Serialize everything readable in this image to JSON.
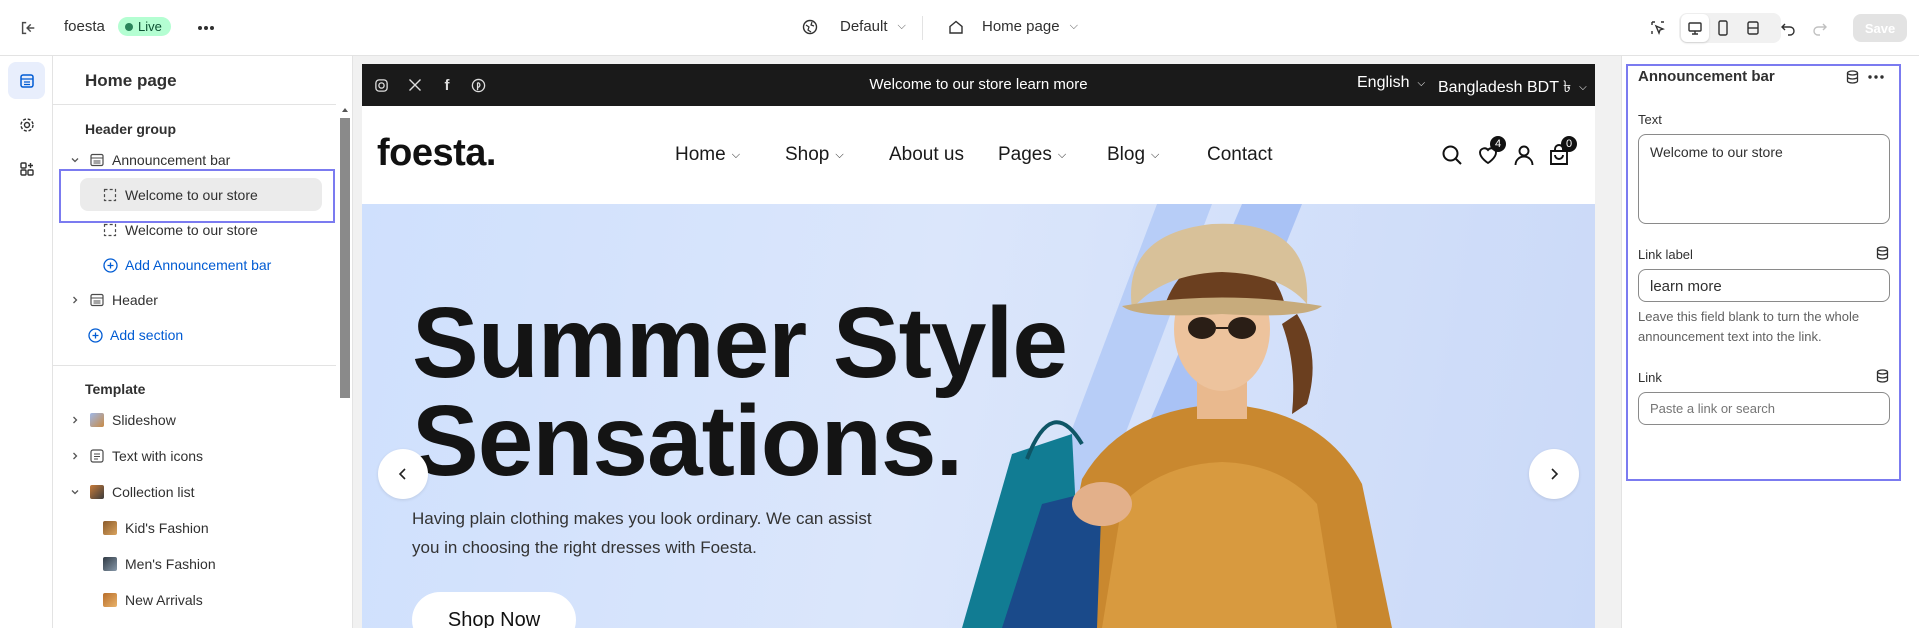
{
  "topbar": {
    "store_name": "foesta",
    "status": "Live",
    "theme": "Default",
    "page": "Home page",
    "save_label": "Save"
  },
  "sidebar": {
    "title": "Home page",
    "header_group": {
      "label": "Header group",
      "announcement_bar": "Announcement bar",
      "announcements": [
        "Welcome to our store",
        "Welcome to our store"
      ],
      "add_block": "Add Announcement bar",
      "header": "Header",
      "add_section": "Add section"
    },
    "template": {
      "label": "Template",
      "slideshow": "Slideshow",
      "text_with_icons": "Text with icons",
      "collection_list": "Collection list",
      "collections": [
        "Kid's Fashion",
        "Men's Fashion",
        "New Arrivals"
      ]
    }
  },
  "preview": {
    "announcement": {
      "text": "Welcome to our store",
      "link": "learn more",
      "language": "English",
      "currency": "Bangladesh BDT ৳"
    },
    "logo": "foesta.",
    "nav": [
      "Home",
      "Shop",
      "About us",
      "Pages",
      "Blog",
      "Contact"
    ],
    "wishlist_count": "4",
    "cart_count": "0",
    "hero": {
      "title_line1": "Summer Style",
      "title_line2": "Sensations.",
      "subtitle": "Having plain clothing makes you look ordinary. We can assist you in choosing the right dresses with Foesta.",
      "button": "Shop Now"
    }
  },
  "settings": {
    "title": "Announcement bar",
    "text_label": "Text",
    "text_value": "Welcome to our store",
    "link_label_label": "Link label",
    "link_label_value": "learn more",
    "link_label_help": "Leave this field blank to turn the whole announcement text into the link.",
    "link_label": "Link",
    "link_placeholder": "Paste a link or search"
  },
  "colors": {
    "accent_link": "#005bd3",
    "highlight": "#7b7bf0",
    "live_badge": "#b4fed2",
    "hero_bg": "#cfe0fd"
  }
}
